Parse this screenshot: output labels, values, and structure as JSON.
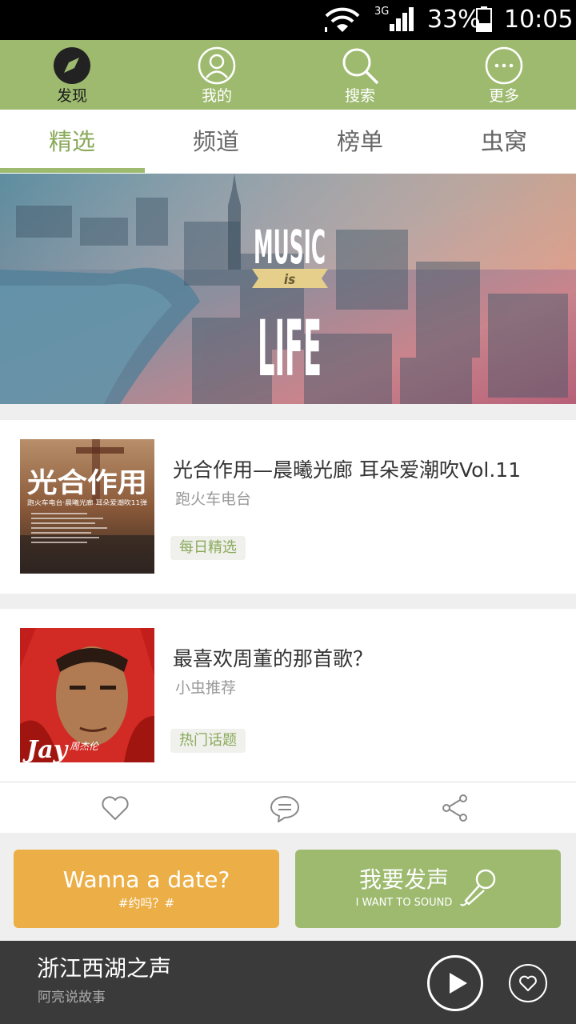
{
  "status_bar": {
    "network": "3G",
    "battery": "33%",
    "time": "10:05"
  },
  "top_nav": [
    {
      "label": "发现",
      "icon": "compass-icon",
      "active": true
    },
    {
      "label": "我的",
      "icon": "user-icon",
      "active": false
    },
    {
      "label": "搜索",
      "icon": "search-icon",
      "active": false
    },
    {
      "label": "更多",
      "icon": "more-icon",
      "active": false
    }
  ],
  "tabs": [
    {
      "label": "精选",
      "active": true
    },
    {
      "label": "频道",
      "active": false
    },
    {
      "label": "榜单",
      "active": false
    },
    {
      "label": "虫窝",
      "active": false
    }
  ],
  "banner": {
    "line1": "MUSIC",
    "line2": "is",
    "line3": "LIFE"
  },
  "cards": [
    {
      "title": "光合作用—晨曦光廊  耳朵爱潮吹Vol.11",
      "source": "跑火车电台",
      "tag": "每日精选",
      "cover_text": "光合作用",
      "cover_sub": "跑火车电台·晨曦光廊 耳朵爱潮吹11弹"
    },
    {
      "title": "最喜欢周董的那首歌？",
      "source": "小虫推荐",
      "tag": "热门话题",
      "cover_text": "Jay",
      "cover_sub": "周杰伦"
    }
  ],
  "actions": [
    {
      "icon": "heart-icon"
    },
    {
      "icon": "comment-icon"
    },
    {
      "icon": "share-icon"
    }
  ],
  "buttons": {
    "date": {
      "label": "Wanna a date?",
      "sub": "#约吗？#"
    },
    "voice": {
      "label": "我要发声",
      "sub": "I WANT TO SOUND"
    }
  },
  "player": {
    "title": "浙江西湖之声",
    "subtitle": "阿亮说故事"
  },
  "colors": {
    "accent_green": "#9dba6f",
    "accent_orange": "#ecaf47",
    "player_bg": "#3a3a3a"
  }
}
